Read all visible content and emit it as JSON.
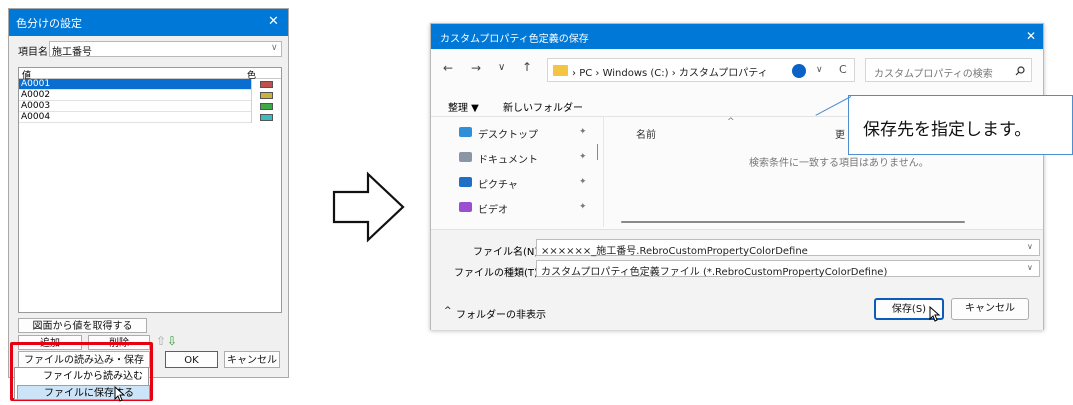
{
  "left_dialog": {
    "title": "色分けの設定",
    "close": "✕",
    "item_label": "項目名",
    "item_value": "施工番号",
    "col_value": "値",
    "col_color": "色",
    "rows": [
      {
        "value": "A0001",
        "color": "#c0504d"
      },
      {
        "value": "A0002",
        "color": "#c8b43c"
      },
      {
        "value": "A0003",
        "color": "#3caa46"
      },
      {
        "value": "A0004",
        "color": "#3cbcc0"
      }
    ],
    "get_from_drawing": "図面から値を取得する",
    "add": "追加",
    "delete": "削除",
    "up_arrow": "⇧",
    "down_arrow": "⇩",
    "file_menu": "ファイルの読み込み・保存 ▼",
    "ok": "OK",
    "cancel": "キャンセル",
    "menu_items": [
      "ファイルから読み込む",
      "ファイルに保存する"
    ]
  },
  "right_dialog": {
    "title": "カスタムプロパティ色定義の保存",
    "close": "✕",
    "nav_back": "←",
    "nav_forward": "→",
    "nav_down": "∨",
    "nav_up": "↑",
    "path": [
      "PC",
      "Windows (C:)",
      "カスタムプロパティ"
    ],
    "path_sep": "›",
    "refresh": "C",
    "search_placeholder": "カスタムプロパティの検索",
    "organize": "整理 ▼",
    "new_folder": "新しいフォルダー",
    "sidebar": [
      {
        "label": "デスクトップ",
        "icon": "desktop-icon",
        "color": "#2f8fd8"
      },
      {
        "label": "ドキュメント",
        "icon": "document-icon",
        "color": "#8a95a6"
      },
      {
        "label": "ピクチャ",
        "icon": "picture-icon",
        "color": "#1f6fc6"
      },
      {
        "label": "ビデオ",
        "icon": "video-icon",
        "color": "#9b4fd0"
      }
    ],
    "col_name": "名前",
    "col_updated": "更",
    "empty_message": "検索条件に一致する項目はありません。",
    "filename_label": "ファイル名(N):",
    "filename_value": "××××××_施工番号.RebroCustomPropertyColorDefine",
    "filetype_label": "ファイルの種類(T):",
    "filetype_value": "カスタムプロパティ色定義ファイル (*.RebroCustomPropertyColorDefine)",
    "hide_folders": "フォルダーの非表示",
    "save": "保存(S)",
    "cancel": "キャンセル"
  },
  "callout": "保存先を指定します。"
}
